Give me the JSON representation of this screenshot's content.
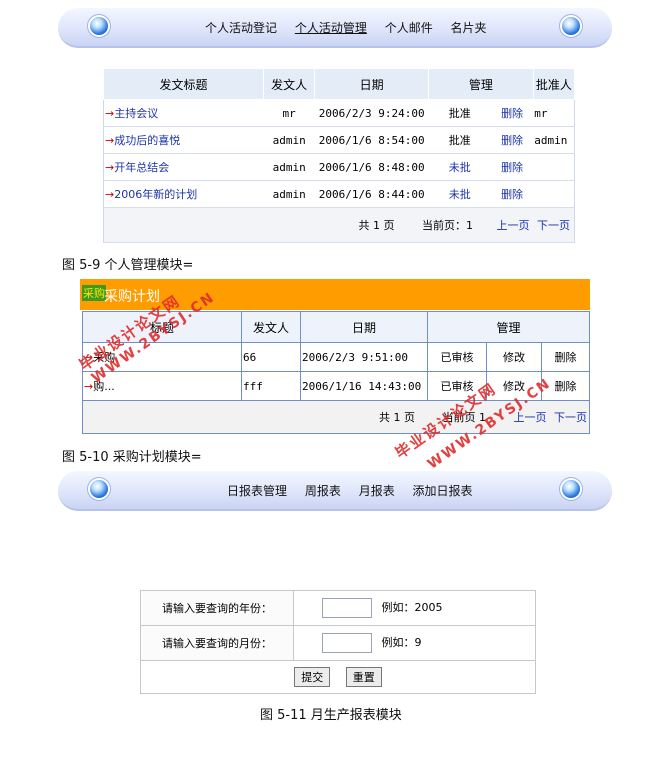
{
  "nav1": {
    "items": [
      "个人活动登记",
      "个人活动管理",
      "个人邮件",
      "名片夹"
    ],
    "active": 1
  },
  "t1": {
    "headers": [
      "发文标题",
      "发文人",
      "日期",
      "管理",
      "批准人"
    ],
    "rows": [
      {
        "title": "主持会议",
        "author": "mr",
        "date": "2006/2/3 9:24:00",
        "status": "批准",
        "action": "删除",
        "approver": "mr"
      },
      {
        "title": "成功后的喜悦",
        "author": "admin",
        "date": "2006/1/6 8:54:00",
        "status": "批准",
        "action": "删除",
        "approver": "admin"
      },
      {
        "title": "开年总结会",
        "author": "admin",
        "date": "2006/1/6 8:48:00",
        "status": "未批",
        "action": "删除",
        "approver": ""
      },
      {
        "title": "2006年新的计划",
        "author": "admin",
        "date": "2006/1/6 8:44:00",
        "status": "未批",
        "action": "删除",
        "approver": ""
      }
    ],
    "footer": {
      "total": "共 1 页",
      "current": "当前页：1",
      "prev": "上一页",
      "next": "下一页"
    }
  },
  "cap1": "图 5-9 个人管理模块=",
  "t2": {
    "banner_icon": "采购",
    "banner": "采购计划",
    "headers": [
      "标题",
      "发文人",
      "日期",
      "管理"
    ],
    "rows": [
      {
        "title": "采购",
        "author": "66",
        "date": "2006/2/3 9:51:00",
        "s": "已审核",
        "e": "修改",
        "d": "删除"
      },
      {
        "title": "购...",
        "author": "fff",
        "date": "2006/1/16 14:43:00",
        "s": "已审核",
        "e": "修改",
        "d": "删除"
      }
    ],
    "footer": {
      "total": "共 1 页",
      "current": "当前页 1",
      "prev": "上一页",
      "next": "下一页"
    }
  },
  "cap2": "图 5-10 采购计划模块=",
  "nav2": {
    "items": [
      "日报表管理",
      "周报表",
      "月报表",
      "添加日报表"
    ]
  },
  "form": {
    "year_label": "请输入要查询的年份：",
    "year_hint": "例如：2005",
    "month_label": "请输入要查询的月份：",
    "month_hint": "例如：9",
    "submit": "提交",
    "reset": "重置"
  },
  "cap3": "图 5-11 月生产报表模块",
  "watermarks": [
    "毕业设计论文网",
    "WWW.2BYSJ.CN"
  ]
}
